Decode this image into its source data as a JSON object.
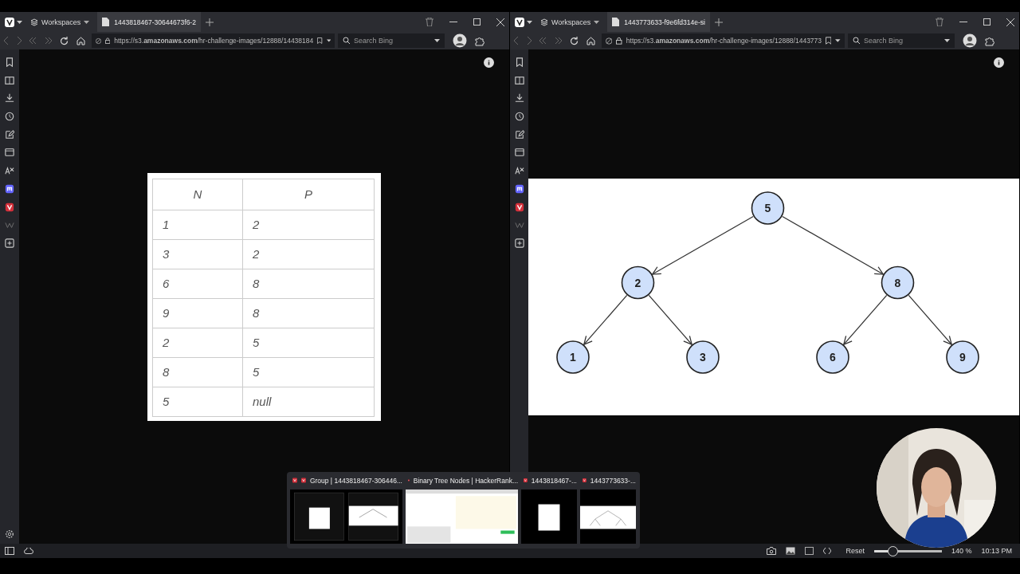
{
  "panes": [
    {
      "workspaces": "Workspaces",
      "tab_title": "1443818467-30644673f6-2",
      "url": "https://s3.**amazonaws.com**/hr-challenge-images/12888/14438184",
      "search": {
        "placeholder": "Search Bing"
      },
      "content": {
        "kind": "table",
        "columns": [
          "N",
          "P"
        ],
        "rows": [
          [
            "1",
            "2"
          ],
          [
            "3",
            "2"
          ],
          [
            "6",
            "8"
          ],
          [
            "9",
            "8"
          ],
          [
            "2",
            "5"
          ],
          [
            "8",
            "5"
          ],
          [
            "5",
            "null"
          ]
        ]
      }
    },
    {
      "workspaces": "Workspaces",
      "tab_title": "1443773633-f9e6fd314e-si",
      "url": "https://s3.**amazonaws.com**/hr-challenge-images/12888/1443773",
      "search": {
        "placeholder": "Search Bing"
      },
      "content": {
        "kind": "tree",
        "root": {
          "value": "5",
          "children": [
            {
              "value": "2",
              "children": [
                {
                  "value": "1"
                },
                {
                  "value": "3"
                }
              ]
            },
            {
              "value": "8",
              "children": [
                {
                  "value": "6"
                },
                {
                  "value": "9"
                }
              ]
            }
          ]
        }
      }
    }
  ],
  "tab_previews": [
    {
      "kind": "group",
      "title": "Group | 1443818467-306446...",
      "thumbnail": {
        "kind": "split"
      }
    },
    {
      "kind": "tab",
      "title": "Binary Tree Nodes | HackerRank...",
      "thumbnail": {
        "kind": "page"
      }
    },
    {
      "kind": "tab",
      "title": "1443818467-...",
      "thumbnail": {
        "kind": "table"
      }
    },
    {
      "kind": "tab",
      "title": "1443773633-...",
      "thumbnail": {
        "kind": "tree"
      }
    }
  ],
  "status_bar": {
    "reset": "Reset",
    "zoom_slider": {
      "level": 0.27
    },
    "zoom": "140 %",
    "clock": "10:13 PM"
  }
}
